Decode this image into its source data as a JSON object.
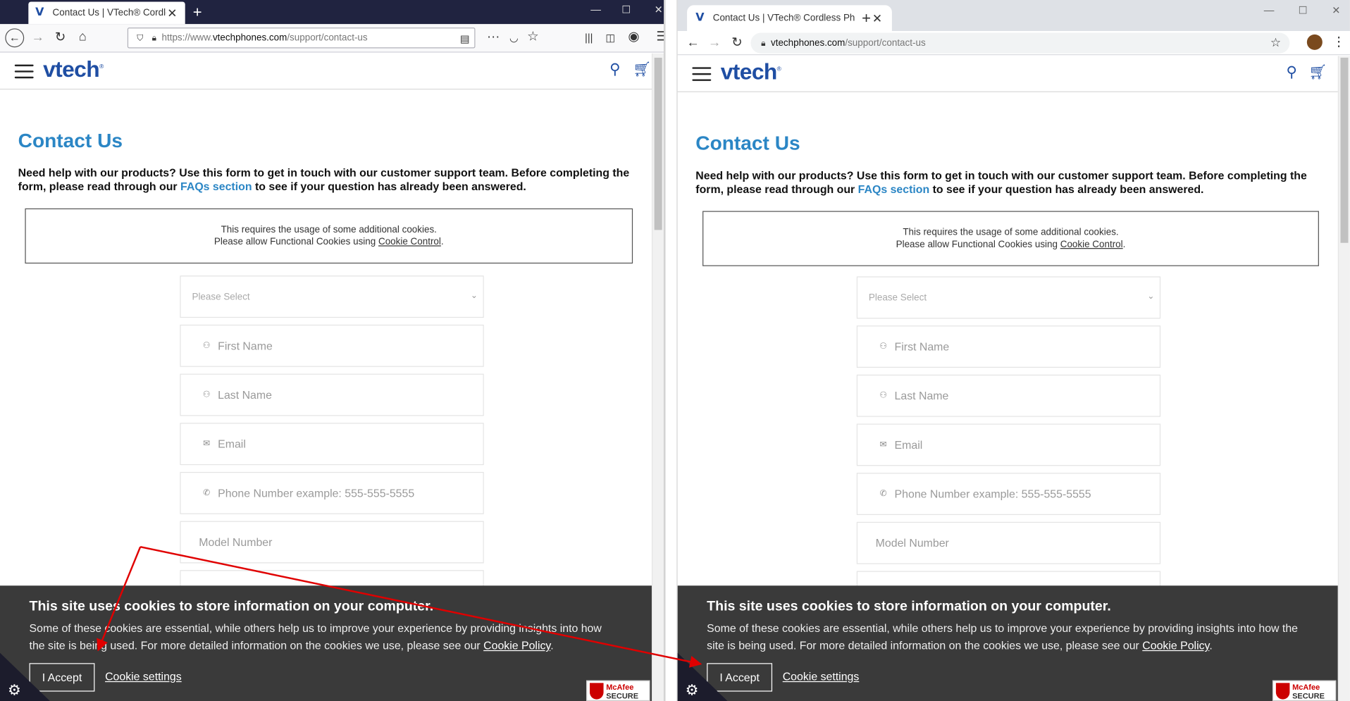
{
  "left_window": {
    "tab_title": "Contact Us | VTech® Cordless P",
    "tab_close": "✕",
    "new_tab": "+",
    "url_prefix": "https://www.",
    "url_host": "vtechphones.com",
    "url_path": "/support/contact-us"
  },
  "right_window": {
    "tab_title": "Contact Us | VTech® Cordless Ph",
    "tab_close": "✕",
    "new_tab": "+",
    "url_host": "vtechphones.com",
    "url_path": "/support/contact-us"
  },
  "site": {
    "logo": "vtech",
    "logo_mark": "®",
    "title": "Contact Us",
    "intro_before": "Need help with our products? Use this form to get in touch with our customer support team. Before completing the form, please read through our ",
    "intro_link": "FAQs section",
    "intro_after": " to see if your question has already been answered.",
    "cookie_notice_line1": "This requires the usage of some additional cookies.",
    "cookie_notice_line2_before": "Please allow Functional Cookies using ",
    "cookie_notice_link": "Cookie Control",
    "cookie_notice_end": ".",
    "form": {
      "select_placeholder": "Please Select",
      "first_name": "First Name",
      "last_name": "Last Name",
      "email": "Email",
      "phone": "Phone Number  example: 555-555-5555",
      "model": "Model Number"
    }
  },
  "cookie_banner": {
    "title": "This site uses cookies to store information on your computer.",
    "text_before": "Some of these cookies are essential, while others help us to improve your experience by providing insights into how the site is being used. For more detailed information on the cookies we use, please see our ",
    "policy_link": "Cookie Policy",
    "text_end": ".",
    "accept": "I Accept",
    "settings": "Cookie settings"
  },
  "badge": {
    "line1": "McAfee",
    "line2": "SECURE"
  },
  "colors": {
    "brand_blue": "#1f4ea3",
    "link_blue": "#2b86c5",
    "banner_bg": "#3a3a3a",
    "annotation_arrow": "#e00000"
  }
}
